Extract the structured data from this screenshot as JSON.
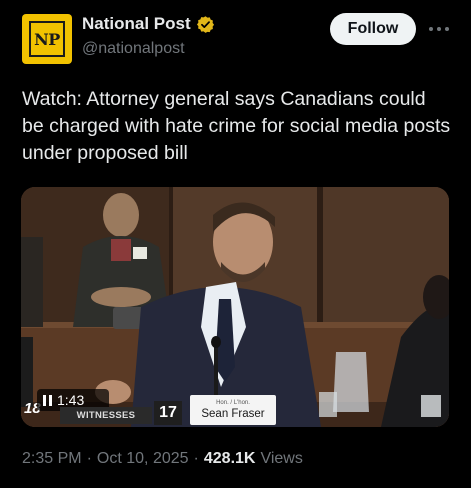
{
  "account": {
    "display_name": "National Post",
    "handle": "@nationalpost",
    "avatar_text": "NP",
    "verified": true,
    "avatar_color": "#f2c200",
    "verified_color": "#e2b719"
  },
  "actions": {
    "follow_label": "Follow",
    "more_icon": "more-horizontal-icon"
  },
  "tweet": {
    "text": "Watch: Attorney general says Canadians could be charged with hate crime for social media posts under proposed bill"
  },
  "video": {
    "time": "1:43",
    "state": "paused-icon",
    "chyron": {
      "left_number": "18",
      "witnesses_label": "WITNESSES",
      "seat_number": "17",
      "nameplate_title": "Hon. / L'hon.",
      "nameplate_name": "Sean Fraser"
    }
  },
  "footer": {
    "time": "2:35 PM",
    "separator": "·",
    "date": "Oct 10, 2025",
    "views_count": "428.1K",
    "views_label": "Views"
  },
  "colors": {
    "background": "#000000",
    "text_primary": "#e7e9ea",
    "text_secondary": "#71767b",
    "follow_bg": "#eff3f4"
  }
}
